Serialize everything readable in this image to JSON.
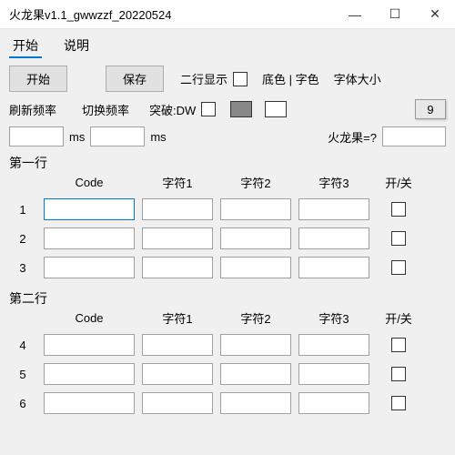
{
  "window": {
    "title": "火龙果v1.1_gwwzzf_20220524",
    "min_icon": "—",
    "max_icon": "☐",
    "close_icon": "✕"
  },
  "tabs": {
    "start": "开始",
    "help": "说明"
  },
  "toolbar": {
    "start_btn": "开始",
    "save_btn": "保存",
    "two_line_display": "二行显示",
    "bg_fg_color": "底色 | 字色",
    "font_size": "字体大小",
    "font_size_value": "9"
  },
  "row2": {
    "refresh_freq": "刷新频率",
    "switch_freq": "切换频率",
    "ms": "ms",
    "breakthrough": "突破:DW",
    "refresh_val": "",
    "switch_val": "",
    "fruit_label": "火龙果=?",
    "fruit_val": ""
  },
  "section1": {
    "title": "第一行",
    "headers": {
      "code": "Code",
      "c1": "字符1",
      "c2": "字符2",
      "c3": "字符3",
      "onoff": "开/关"
    },
    "rows": [
      {
        "num": "1",
        "code": "",
        "c1": "",
        "c2": "",
        "c3": "",
        "on": false
      },
      {
        "num": "2",
        "code": "",
        "c1": "",
        "c2": "",
        "c3": "",
        "on": false
      },
      {
        "num": "3",
        "code": "",
        "c1": "",
        "c2": "",
        "c3": "",
        "on": false
      }
    ]
  },
  "section2": {
    "title": "第二行",
    "headers": {
      "code": "Code",
      "c1": "字符1",
      "c2": "字符2",
      "c3": "字符3",
      "onoff": "开/关"
    },
    "rows": [
      {
        "num": "4",
        "code": "",
        "c1": "",
        "c2": "",
        "c3": "",
        "on": false
      },
      {
        "num": "5",
        "code": "",
        "c1": "",
        "c2": "",
        "c3": "",
        "on": false
      },
      {
        "num": "6",
        "code": "",
        "c1": "",
        "c2": "",
        "c3": "",
        "on": false
      }
    ]
  }
}
